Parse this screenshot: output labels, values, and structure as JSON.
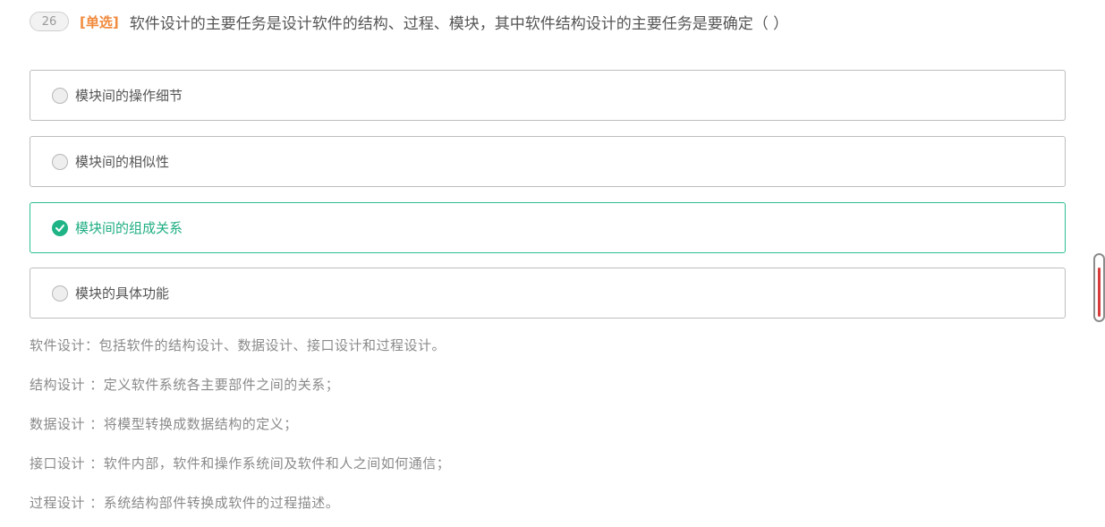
{
  "question": {
    "number": "26",
    "type": "[单选]",
    "text": "软件设计的主要任务是设计软件的结构、过程、模块，其中软件结构设计的主要任务是要确定（  ）"
  },
  "options": [
    {
      "label": "模块间的操作细节",
      "selected": false
    },
    {
      "label": "模块间的相似性",
      "selected": false
    },
    {
      "label": "模块间的组成关系",
      "selected": true
    },
    {
      "label": "模块的具体功能",
      "selected": false
    }
  ],
  "analysis": [
    "软件设计：包括软件的结构设计、数据设计、接口设计和过程设计。",
    "结构设计 ：定义软件系统各主要部件之间的关系；",
    "数据设计 ：将模型转换成数据结构的定义；",
    "接口设计 ：软件内部，软件和操作系统间及软件和人之间如何通信；",
    "过程设计 ：系统结构部件转换成软件的过程描述。"
  ],
  "colors": {
    "accent": "#1fb486",
    "question_type": "#f08a3c",
    "scroll_thumb": "#d93b3b"
  },
  "icons": {
    "selected_radio": "check-circle-icon",
    "unselected_radio": "radio-empty-icon"
  }
}
